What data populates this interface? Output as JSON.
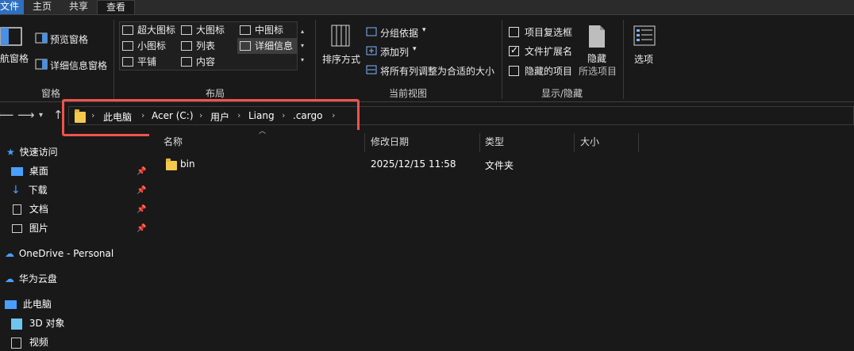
{
  "tabs": [
    "文件",
    "主页",
    "共享",
    "查看"
  ],
  "ribbon": {
    "panes": {
      "nav_pane": "导航窗格",
      "preview_pane": "预览窗格",
      "details_pane": "详细信息窗格",
      "group_label": "窗格"
    },
    "layout": {
      "items": [
        "超大图标",
        "大图标",
        "中图标",
        "小图标",
        "列表",
        "详细信息",
        "平铺",
        "内容"
      ],
      "selected": "详细信息",
      "group_label": "布局"
    },
    "current_view": {
      "sort_by": "排序方式",
      "group_by": "分组依据",
      "add_columns": "添加列",
      "size_all_columns": "将所有列调整为合适的大小",
      "group_label": "当前视图"
    },
    "show_hide": {
      "item_checkboxes": "项目复选框",
      "item_checkboxes_checked": false,
      "file_extensions": "文件扩展名",
      "file_extensions_checked": true,
      "hidden_items": "隐藏的项目",
      "hidden_items_checked": false,
      "hide_selected": "隐藏",
      "hide_selected_sub": "所选项目",
      "group_label": "显示/隐藏"
    },
    "options": "选项"
  },
  "address": {
    "crumbs": [
      "此电脑",
      "Acer (C:)",
      "用户",
      "Liang",
      ".cargo"
    ]
  },
  "sidebar": {
    "quick_access": "快速访问",
    "pinned": [
      "桌面",
      "下载",
      "文档",
      "图片"
    ],
    "onedrive": "OneDrive - Personal",
    "huawei_cloud": "华为云盘",
    "this_pc": "此电脑",
    "pc_items": [
      "3D 对象",
      "视频"
    ]
  },
  "columns": [
    "名称",
    "修改日期",
    "类型",
    "大小"
  ],
  "files": [
    {
      "name": "bin",
      "modified": "2025/12/15 11:58",
      "type": "文件夹",
      "size": ""
    }
  ],
  "colors": {
    "accent": "#2f6fc0",
    "highlight_box": "#f0524d",
    "folder": "#f3c94e"
  }
}
